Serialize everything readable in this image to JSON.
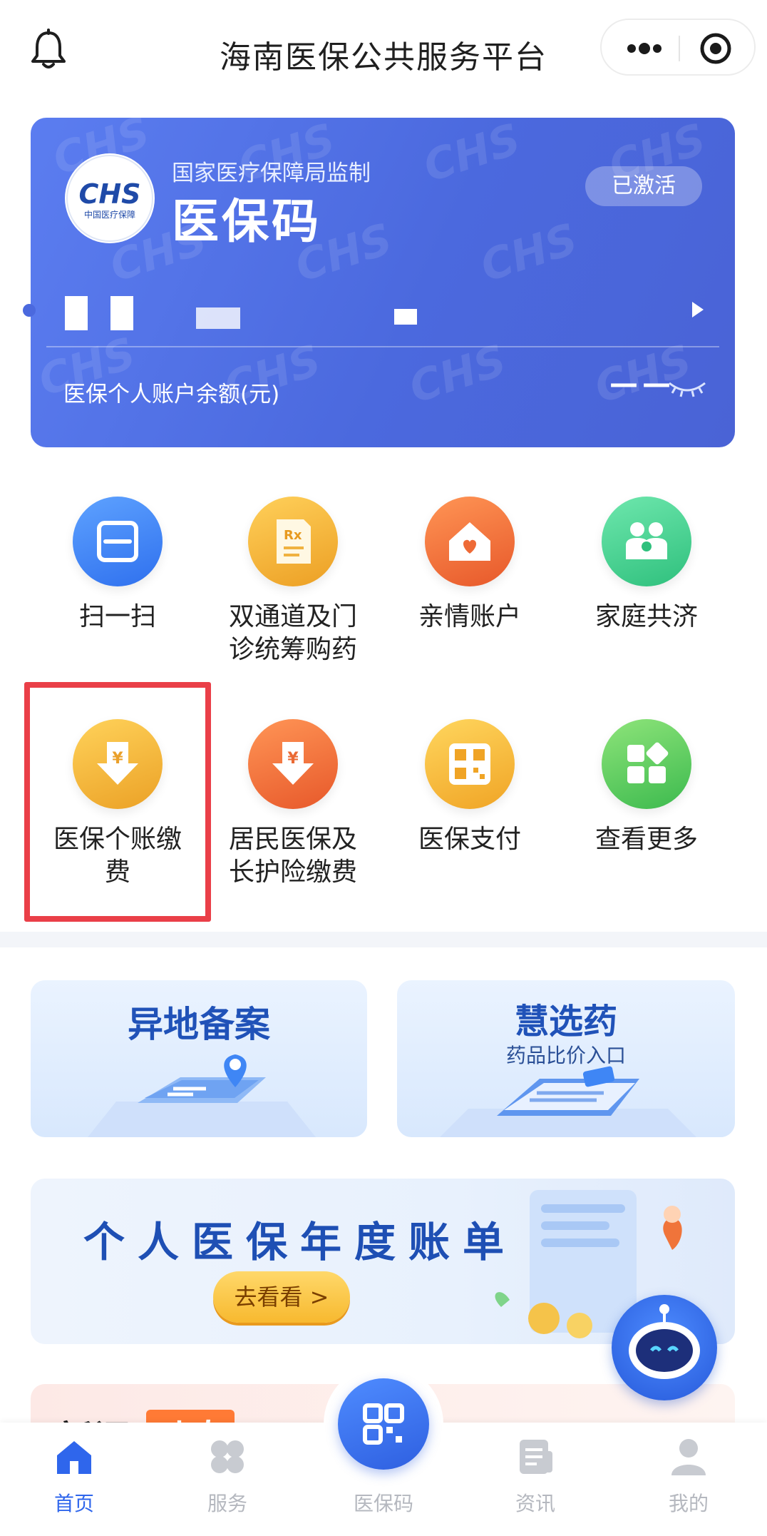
{
  "header": {
    "title": "海南医保公共服务平台",
    "icons": {
      "left": "bell-icon",
      "more": "more-dots-icon",
      "close": "target-circle-icon"
    }
  },
  "card": {
    "supervisor": "国家医疗保障局监制",
    "title": "医保码",
    "status": "已激活",
    "logo_text": "CHS",
    "logo_caption": "中国医疗保障",
    "balance_label": "医保个人账户余额(元)",
    "balance_value": "——",
    "colors": {
      "gradient_start": "#5b7df0",
      "gradient_end": "#4a63d6"
    }
  },
  "services": [
    {
      "label": "扫一扫",
      "icon": "scan-icon",
      "color": "#3f86f5"
    },
    {
      "label": "双通道及门诊统筹购药",
      "label_line1": "双通道及门",
      "label_line2": "诊统筹购药",
      "icon": "prescription-icon",
      "color": "#f2b030"
    },
    {
      "label": "亲情账户",
      "icon": "home-heart-icon",
      "color": "#f0743a"
    },
    {
      "label": "家庭共济",
      "icon": "family-icon",
      "color": "#3fcf8f"
    },
    {
      "label": "医保个账缴费",
      "label_line1": "医保个账缴",
      "label_line2": "费",
      "icon": "yuan-download-icon",
      "color": "#f2b030"
    },
    {
      "label": "居民医保及长护险缴费",
      "label_line1": "居民医保及",
      "label_line2": "长护险缴费",
      "icon": "yuan-download-icon",
      "color": "#f0743a"
    },
    {
      "label": "医保支付",
      "icon": "qr-pay-icon",
      "color": "#f5b62e"
    },
    {
      "label": "查看更多",
      "icon": "grid-more-icon",
      "color": "#4fc760"
    }
  ],
  "tiles": [
    {
      "title": "异地备案",
      "subtitle": ""
    },
    {
      "title": "慧选药",
      "subtitle": "药品比价入口"
    }
  ],
  "banner": {
    "title": "个人医保年度账单",
    "button": "去看看 >"
  },
  "news": {
    "part1": "新闻",
    "part2": "动态"
  },
  "tabbar": {
    "items": [
      {
        "label": "首页",
        "active": true
      },
      {
        "label": "服务",
        "active": false
      },
      {
        "label": "医保码",
        "active": false
      },
      {
        "label": "资讯",
        "active": false
      },
      {
        "label": "我的",
        "active": false
      }
    ],
    "active_color": "#2f66ec",
    "inactive_color": "#b5b8bf"
  }
}
